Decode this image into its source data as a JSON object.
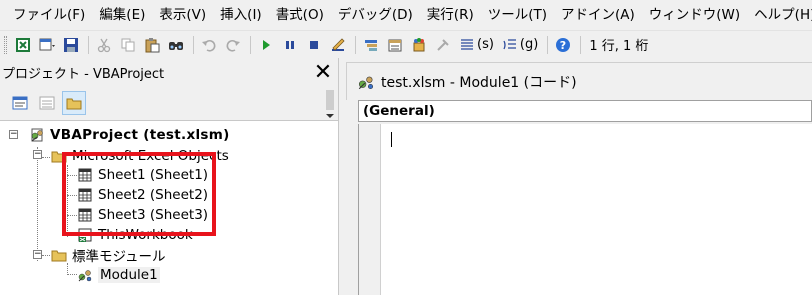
{
  "menubar": {
    "items": [
      "ファイル(F)",
      "編集(E)",
      "表示(V)",
      "挿入(I)",
      "書式(O)",
      "デバッグ(D)",
      "実行(R)",
      "ツール(T)",
      "アドイン(A)",
      "ウィンドウ(W)",
      "ヘルプ(H)"
    ]
  },
  "toolbar": {
    "bookmark_s": "(s)",
    "bookmark_g": "(g)",
    "position": "1 行, 1 桁",
    "colors": {
      "run": "#1e9a2e",
      "stop": "#2b4a9b",
      "help": "#2b6fd6"
    }
  },
  "project": {
    "title": "プロジェクト - VBAProject",
    "close_glyph": "✕",
    "tree": {
      "root": "VBAProject (test.xlsm)",
      "folder_objects": "Microsoft Excel Objects",
      "sheets": [
        "Sheet1 (Sheet1)",
        "Sheet2 (Sheet2)",
        "Sheet3 (Sheet3)"
      ],
      "workbook": "ThisWorkbook",
      "folder_modules": "標準モジュール",
      "module": "Module1"
    },
    "expander_glyph": "−",
    "highlight_color": "#e8131c"
  },
  "code_window": {
    "title": "test.xlsm - Module1 (コード)",
    "object_combo": "(General)"
  }
}
